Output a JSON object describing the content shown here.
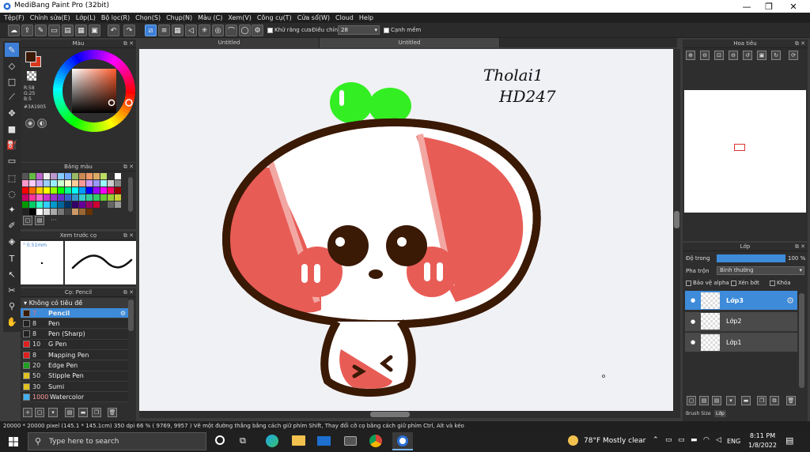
{
  "window": {
    "title": "MediBang Paint Pro (32bit)",
    "minimize": "—",
    "maximize": "❐",
    "close": "✕"
  },
  "menu": [
    "Tệp(F)",
    "Chỉnh sửa(E)",
    "Lớp(L)",
    "Bộ lọc(R)",
    "Chọn(S)",
    "Chụp(N)",
    "Màu (C)",
    "Xem(V)",
    "Công cụ(T)",
    "Cửa sổ(W)",
    "Cloud",
    "Help"
  ],
  "toolbar": {
    "antialias_label": "Khử răng cưa",
    "correction_label": "Điều chỉnh",
    "correction_value": "28",
    "soft_edge_label": "Cạnh mềm"
  },
  "doc_tabs": [
    "Untitled",
    "Untitled"
  ],
  "color_panel": {
    "title": "Màu",
    "r": "R:58",
    "g": "G:25",
    "b": "B:5",
    "hex": "#3A1905",
    "fg_color": "#3a1905",
    "bg_color": "#d9381e"
  },
  "palette_panel": {
    "title": "Bảng màu",
    "more": "···"
  },
  "brush_preview": {
    "title": "Xem trước cọ",
    "size": "0.51mm"
  },
  "brush_panel": {
    "title": "Cọ: Pencil",
    "group": "Không có tiêu đề",
    "items": [
      {
        "size": "7",
        "name": "Pencil",
        "color": "#3a1905",
        "selected": true
      },
      {
        "size": "8",
        "name": "Pen",
        "color": "#222222",
        "selected": false
      },
      {
        "size": "8",
        "name": "Pen (Sharp)",
        "color": "#222222",
        "selected": false
      },
      {
        "size": "10",
        "name": "G Pen",
        "color": "#e02020",
        "selected": false
      },
      {
        "size": "8",
        "name": "Mapping Pen",
        "color": "#e02020",
        "selected": false
      },
      {
        "size": "20",
        "name": "Edge Pen",
        "color": "#20a020",
        "selected": false
      },
      {
        "size": "50",
        "name": "Stipple Pen",
        "color": "#e0c020",
        "selected": false
      },
      {
        "size": "30",
        "name": "Sumi",
        "color": "#e0c020",
        "selected": false
      },
      {
        "size": "1000",
        "name": "Watercolor",
        "color": "#40b0f0",
        "selected": false
      }
    ]
  },
  "navigator": {
    "title": "Hoa tiêu"
  },
  "layer_panel": {
    "title": "Lớp",
    "opacity_label": "Độ trong",
    "opacity_value": "100 %",
    "opacity": 1.0,
    "blend_label": "Pha trộn",
    "blend_value": "Bình thường",
    "protect_alpha": "Bảo vệ alpha",
    "clipping": "Xén bớt",
    "lock": "Khóa",
    "layers": [
      {
        "name": "Lớp3",
        "selected": true
      },
      {
        "name": "Lớp2",
        "selected": false
      },
      {
        "name": "Lớp1",
        "selected": false
      }
    ],
    "bottom_tabs": [
      "Brush Size",
      "Lớp"
    ]
  },
  "canvas": {
    "text_line1": "Tholai1",
    "text_line2": "HD247"
  },
  "status": {
    "text": "20000 * 20000 pixel  (145.1 * 145.1cm)  350 dpi  66 %  ( 9769, 9957 )  Vẽ một đường thẳng bằng cách giữ phím Shift, Thay đổi cỡ cọ bằng cách giữ phím Ctrl, Alt và kéo"
  },
  "taskbar": {
    "search_placeholder": "Type here to search",
    "weather": "78°F  Mostly clear",
    "lang": "ENG",
    "time": "8:11 PM",
    "date": "1/8/2022"
  },
  "icons": {
    "search": "search-icon",
    "windows": "windows-start-icon",
    "cortana": "circle-icon",
    "taskview": "task-view-icon"
  }
}
